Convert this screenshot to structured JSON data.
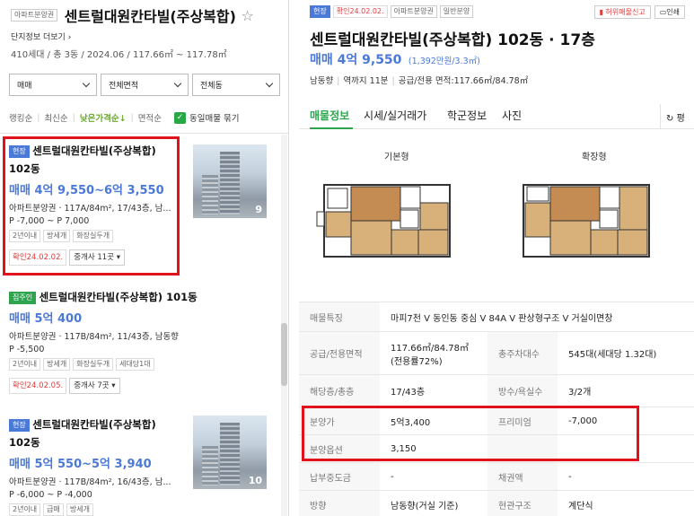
{
  "left": {
    "badge": "아파트분양권",
    "title": "센트럴대원칸타빌(주상복합)",
    "complex_link": "단지정보 더보기",
    "complex_info": "410세대 / 총 3동 / 2024.06 / 117.66㎡ ~ 117.78㎡",
    "filters": [
      "매매",
      "전체면적",
      "전체동"
    ],
    "sort": {
      "options": [
        "랭킹순",
        "최신순",
        "낮은가격순↓",
        "면적순"
      ],
      "active": "낮은가격순↓",
      "same_listing": "동일매물 묶기",
      "check": "✓"
    },
    "listings": [
      {
        "badge": "현장",
        "title": "센트럴대원칸타빌(주상복합)",
        "title2": "102동",
        "price": "매매 4억 9,550~6억 3,550",
        "desc": "아파트분양권 · 117A/84m², 17/43층, 남...",
        "premium": "P -7,000 ~ P 7,000",
        "tags": [
          "2년이내",
          "방세개",
          "화장실두개"
        ],
        "confirm": "확인24.02.02.",
        "agents": "중개사 11곳",
        "photo_count": "9"
      },
      {
        "badge": "집주인",
        "title": "센트럴대원칸타빌(주상복합) 101동",
        "price": "매매 5억 400",
        "desc": "아파트분양권 · 117B/84m², 11/43층, 남동향",
        "premium": "P -5,500",
        "tags": [
          "2년이내",
          "방세개",
          "화장실두개",
          "세대당1대"
        ],
        "confirm": "확인24.02.05.",
        "agents": "중개사 7곳"
      },
      {
        "badge": "현장",
        "title": "센트럴대원칸타빌(주상복합)",
        "title2": "102동",
        "price": "매매 5억 550~5억 3,940",
        "desc": "아파트분양권 · 117B/84m², 16/43층, 남...",
        "premium": "P -6,000 ~ P -4,000",
        "tags": [
          "2년이내",
          "급매",
          "방세개"
        ],
        "photo_count": "10"
      }
    ]
  },
  "right": {
    "badges": [
      "현장",
      "확인24.02.02.",
      "아파트분양권",
      "일반분양"
    ],
    "actions": [
      "허위매물신고",
      "인쇄"
    ],
    "title": "센트럴대원칸타빌(주상복합) 102동 · 17층",
    "price": "매매 4억 9,550",
    "price_sub": "(1,392만원/3.3㎡)",
    "meta": [
      "남동향",
      "역까지 11분",
      "공급/전용 면적:117.66㎡/84.78㎡"
    ],
    "tabs": [
      "매물정보",
      "시세/실거래가",
      "학군정보",
      "사진"
    ],
    "tab_active": "매물정보",
    "tab_more": "평",
    "floorplans": [
      "기본형",
      "확장형"
    ],
    "info": [
      {
        "k": "매물특징",
        "v": "마피7천 V 동인동 중심 V 84A V 판상형구조 V 거실이면창"
      },
      {
        "k": "공급/전용면적",
        "v": "117.66㎡/84.78㎡(전용률72%)",
        "k2": "총주차대수",
        "v2": "545대(세대당 1.32대)"
      },
      {
        "k": "해당층/총층",
        "v": "17/43층",
        "k2": "방수/욕실수",
        "v2": "3/2개"
      },
      {
        "k": "분양가",
        "v": "5억3,400",
        "k2": "프리미엄",
        "v2": "-7,000"
      },
      {
        "k": "분양옵션",
        "v": "3,150",
        "k2": "",
        "v2": ""
      },
      {
        "k": "납부중도금",
        "v": "-",
        "k2": "채권액",
        "v2": "-"
      },
      {
        "k": "방향",
        "v": "남동향(거실 기준)",
        "k2": "현관구조",
        "v2": "계단식"
      }
    ]
  },
  "colors": {
    "accent_blue": "#4a79d8",
    "accent_green": "#2ea44f",
    "highlight_red": "#e0121b",
    "confirm_red": "#e03c3c"
  }
}
